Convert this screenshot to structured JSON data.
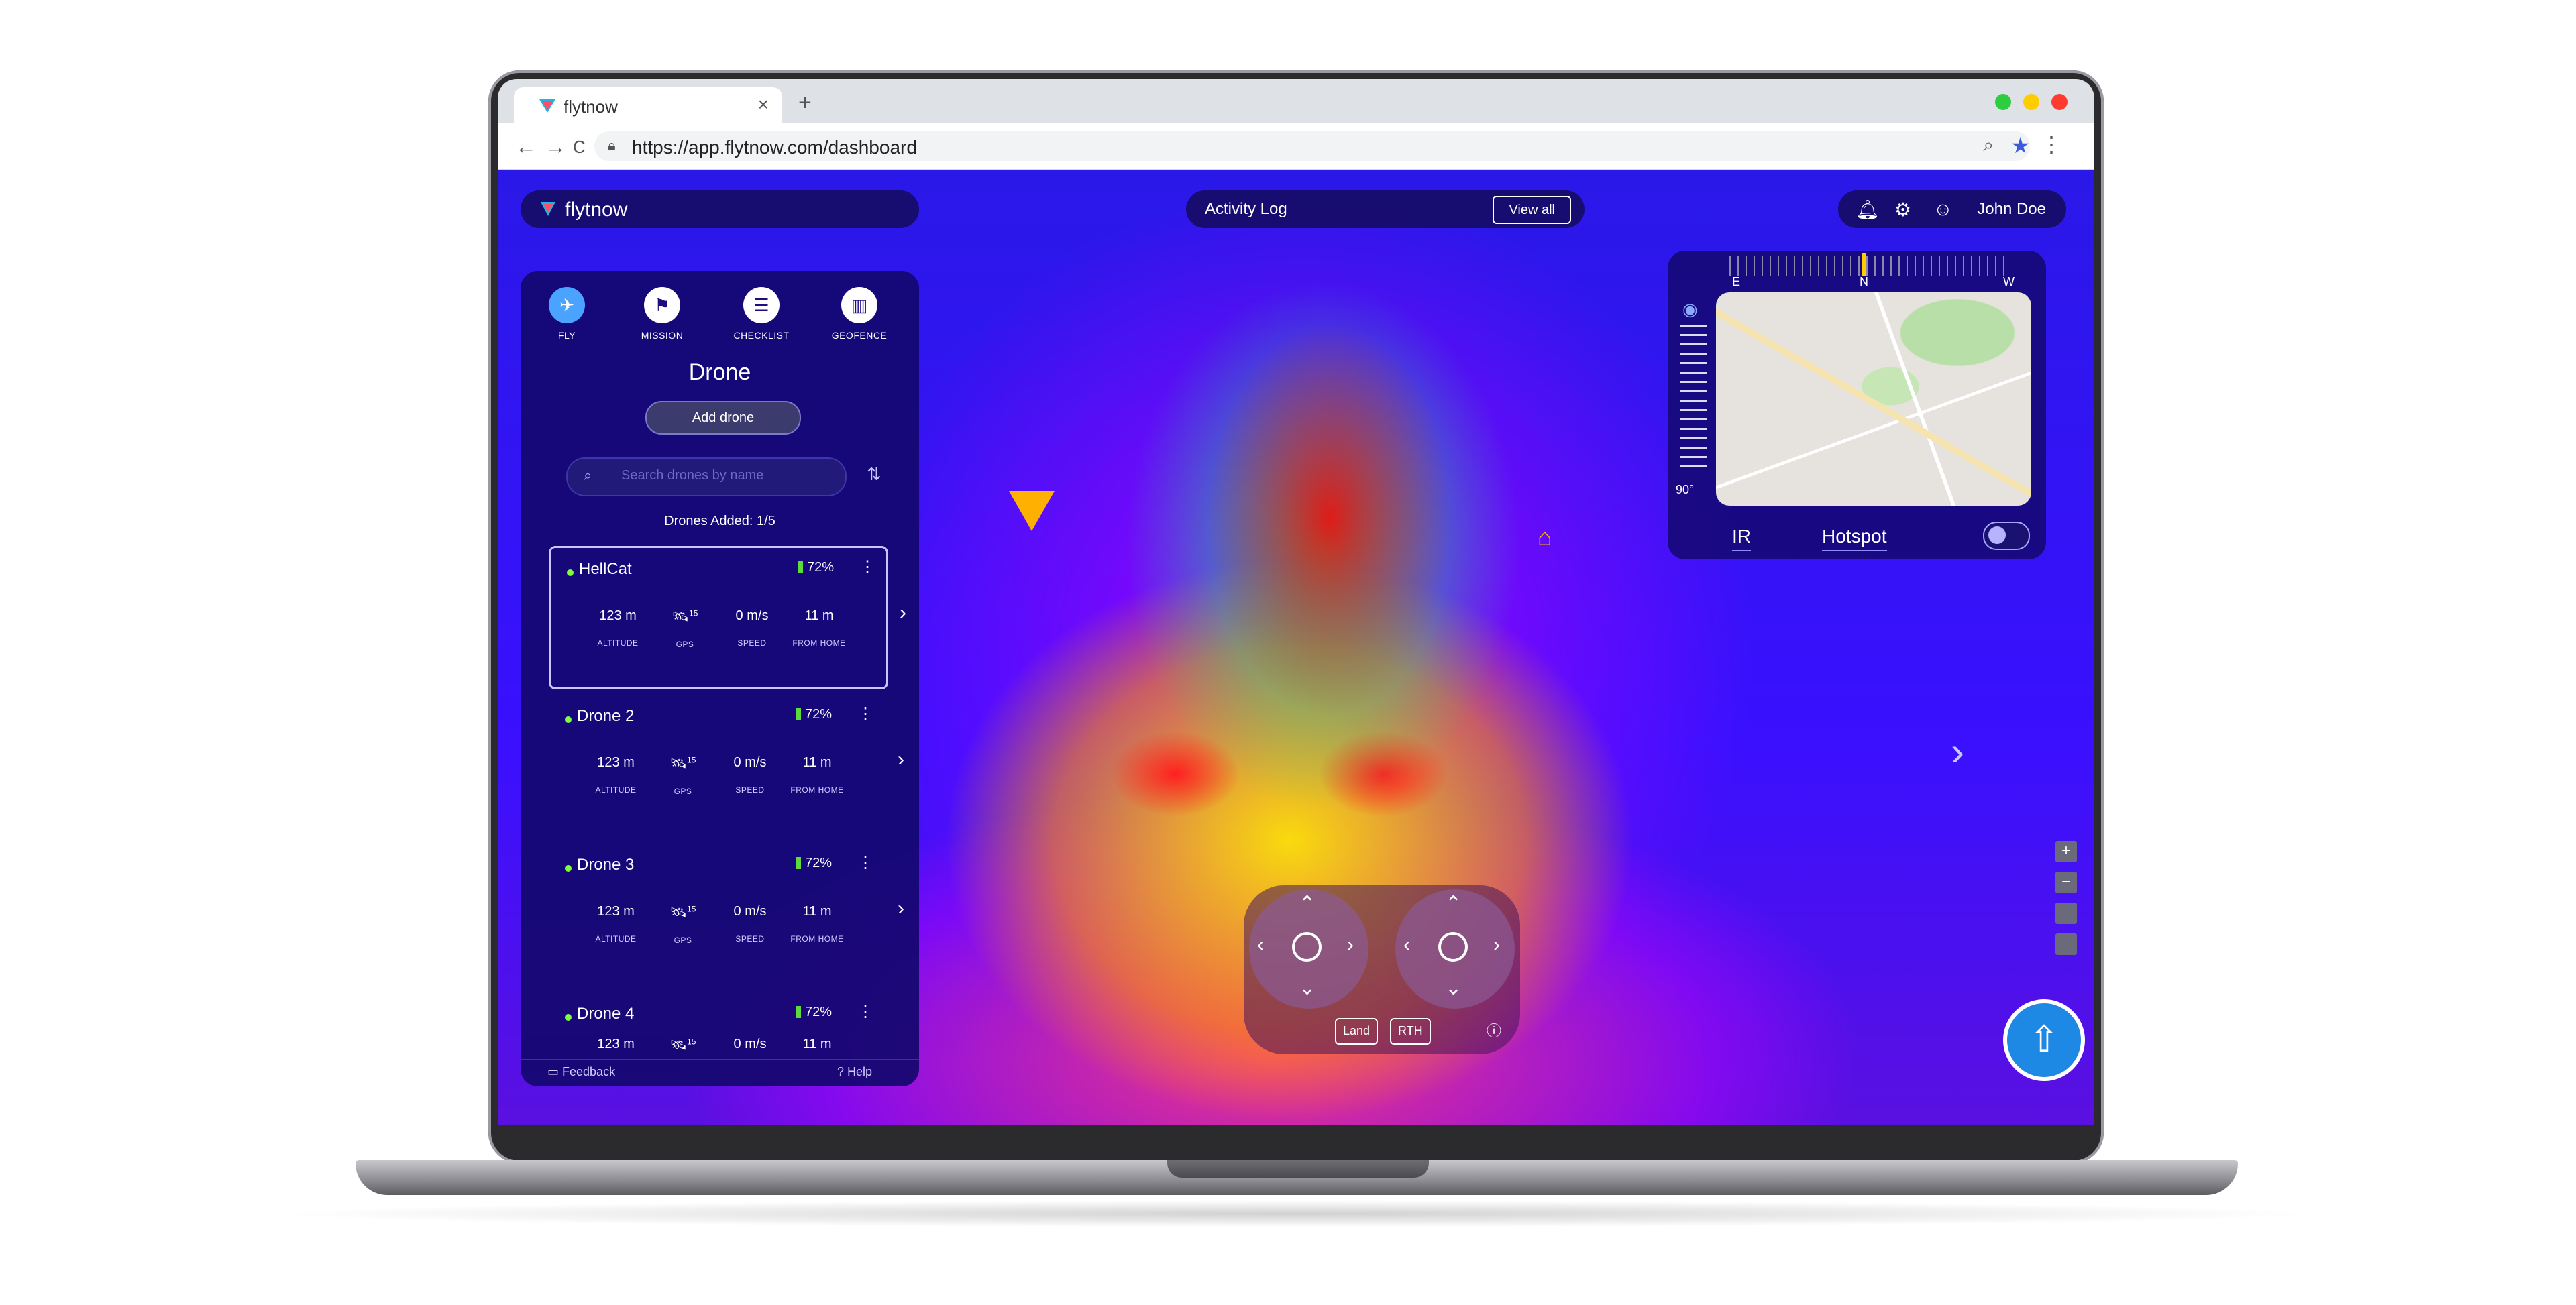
{
  "browser": {
    "tab_title": "flytnow",
    "tab_close": "×",
    "new_tab": "+",
    "url": "https://app.flytnow.com/dashboard",
    "back": "←",
    "forward": "→",
    "reload": "C",
    "zoom_icon": "⌕",
    "star_icon": "★",
    "menu_icon": "⋮",
    "window_dots": [
      "#2ecc40",
      "#ffcc00",
      "#ff3b30"
    ]
  },
  "app": {
    "brand": "flytnow",
    "activity_log": "Activity Log",
    "view_all": "View all",
    "user_name": "John Doe",
    "modes": [
      {
        "label": "FLY",
        "icon": "✈",
        "active": true
      },
      {
        "label": "MISSION",
        "icon": "⚑",
        "active": false
      },
      {
        "label": "CHECKLIST",
        "icon": "☰",
        "active": false
      },
      {
        "label": "GEOFENCE",
        "icon": "▥",
        "active": false
      }
    ],
    "panel_title": "Drone",
    "add_drone": "Add drone",
    "search_placeholder": "Search drones by name",
    "drones_added": "Drones Added: 1/5",
    "stat_labels": [
      "ALTITUDE",
      "GPS",
      "SPEED",
      "FROM HOME"
    ],
    "drones": [
      {
        "name": "HellCat",
        "battery": "72%",
        "altitude": "123 m",
        "gps": "15",
        "speed": "0 m/s",
        "from_home": "11 m"
      },
      {
        "name": "Drone 2",
        "battery": "72%",
        "altitude": "123 m",
        "gps": "15",
        "speed": "0 m/s",
        "from_home": "11 m"
      },
      {
        "name": "Drone 3",
        "battery": "72%",
        "altitude": "123 m",
        "gps": "15",
        "speed": "0 m/s",
        "from_home": "11 m"
      },
      {
        "name": "Drone 4",
        "battery": "72%",
        "altitude": "123 m",
        "gps": "15",
        "speed": "0 m/s",
        "from_home": "11 m"
      }
    ],
    "feedback": "Feedback",
    "help": "Help",
    "compass": {
      "e": "E",
      "n": "N",
      "w": "W"
    },
    "gimbal_angle": "90°",
    "map_tabs": [
      "IR",
      "Hotspot"
    ],
    "zoom_in": "+",
    "zoom_out": "−",
    "land": "Land",
    "rth": "RTH"
  }
}
